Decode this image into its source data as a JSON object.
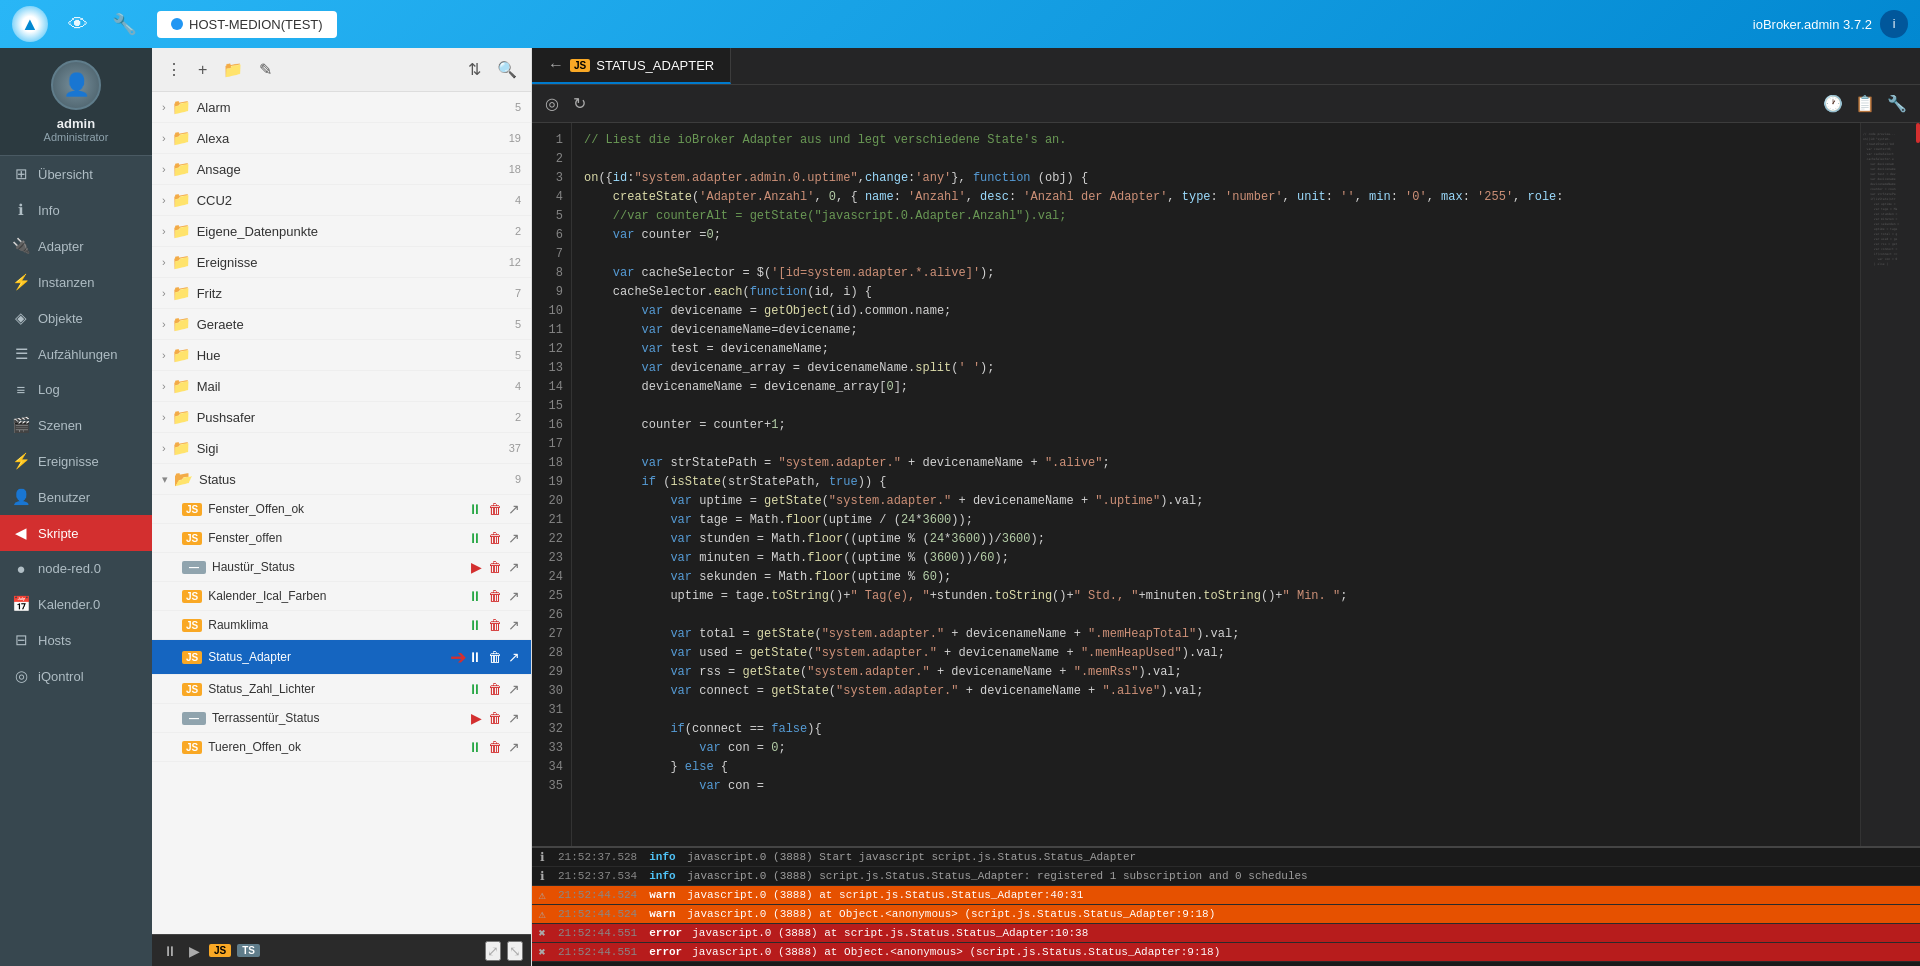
{
  "topbar": {
    "logo_text": "▲",
    "eye_icon": "👁",
    "wrench_icon": "🔧",
    "host_label": "HOST-MEDION(TEST)",
    "app_version": "ioBroker.admin 3.7.2",
    "right_icon": "i"
  },
  "sidebar": {
    "username": "admin",
    "role": "Administrator",
    "items": [
      {
        "id": "uebersicht",
        "label": "Übersicht",
        "icon": "⊞"
      },
      {
        "id": "info",
        "label": "Info",
        "icon": "ℹ"
      },
      {
        "id": "adapter",
        "label": "Adapter",
        "icon": "🧩"
      },
      {
        "id": "instanzen",
        "label": "Instanzen",
        "icon": "⚡"
      },
      {
        "id": "objekte",
        "label": "Objekte",
        "icon": "◈"
      },
      {
        "id": "aufzaehlungen",
        "label": "Aufzählungen",
        "icon": "☰"
      },
      {
        "id": "log",
        "label": "Log",
        "icon": "≡",
        "active": true
      },
      {
        "id": "szenen",
        "label": "Szenen",
        "icon": "🎬"
      },
      {
        "id": "ereignisse",
        "label": "Ereignisse",
        "icon": "⚡"
      },
      {
        "id": "benutzer",
        "label": "Benutzer",
        "icon": "👤"
      },
      {
        "id": "skripte",
        "label": "Skripte",
        "icon": "◀",
        "highlighted": true
      },
      {
        "id": "node-red",
        "label": "node-red.0",
        "icon": "●"
      },
      {
        "id": "kalender",
        "label": "Kalender.0",
        "icon": "📅"
      },
      {
        "id": "hosts",
        "label": "Hosts",
        "icon": "⊟"
      },
      {
        "id": "iqontrol",
        "label": "iQontrol",
        "icon": "◎"
      }
    ]
  },
  "script_panel": {
    "toolbar": {
      "menu_icon": "⋮",
      "add_icon": "+",
      "folder_icon": "📁",
      "edit_icon": "✎",
      "sort_icon": "⇅",
      "search_icon": "🔍"
    },
    "folders": [
      {
        "name": "Alarm",
        "count": 5,
        "open": false
      },
      {
        "name": "Alexa",
        "count": 19,
        "open": false
      },
      {
        "name": "Ansage",
        "count": 18,
        "open": false
      },
      {
        "name": "CCU2",
        "count": 4,
        "open": false
      },
      {
        "name": "Eigene_Datenpunkte",
        "count": 2,
        "open": false
      },
      {
        "name": "Ereignisse",
        "count": 12,
        "open": false
      },
      {
        "name": "Fritz",
        "count": 7,
        "open": false
      },
      {
        "name": "Geraete",
        "count": 5,
        "open": false
      },
      {
        "name": "Hue",
        "count": 5,
        "open": false
      },
      {
        "name": "Mail",
        "count": 4,
        "open": false
      },
      {
        "name": "Pushsafer",
        "count": 2,
        "open": false
      },
      {
        "name": "Sigi",
        "count": 37,
        "open": false
      }
    ],
    "status_folder": {
      "name": "Status",
      "count": 9,
      "open": true,
      "items": [
        {
          "name": "Fenster_Offen_ok",
          "type": "js",
          "running": true
        },
        {
          "name": "Fenster_offen",
          "type": "js",
          "running": true
        },
        {
          "name": "Haustür_Status",
          "type": "dash",
          "running": false
        },
        {
          "name": "Kalender_Ical_Farben",
          "type": "js",
          "running": true
        },
        {
          "name": "Raumklima",
          "type": "js",
          "running": true
        },
        {
          "name": "Status_Adapter",
          "type": "js",
          "running": true,
          "selected": true
        },
        {
          "name": "Status_Zahl_Lichter",
          "type": "js",
          "running": true
        },
        {
          "name": "Terrassentür_Status",
          "type": "dash",
          "running": false
        },
        {
          "name": "Tueren_Offen_ok",
          "type": "js",
          "running": true
        }
      ]
    }
  },
  "editor": {
    "tab_label": "STATUS_ADAPTER",
    "back_label": "←",
    "code_lines": [
      {
        "n": 1,
        "text": "// Liest die ioBroker Adapter aus und legt verschiedene State's an.",
        "type": "comment"
      },
      {
        "n": 2,
        "text": "",
        "type": "blank"
      },
      {
        "n": 3,
        "text": "on({id:\"system.adapter.admin.0.uptime\",change:'any'}, function (obj) {",
        "type": "code"
      },
      {
        "n": 4,
        "text": "    createState('Adapter.Anzahl', 0, { name: 'Anzahl', desc: 'Anzahl der Adapter', type: 'number', unit: '', min: '0', max: '255', role:",
        "type": "code"
      },
      {
        "n": 5,
        "text": "    //var counterAlt = getState(\"javascript.0.Adapter.Anzahl\").val;",
        "type": "comment"
      },
      {
        "n": 6,
        "text": "    var counter =0;",
        "type": "code"
      },
      {
        "n": 7,
        "text": "",
        "type": "blank"
      },
      {
        "n": 8,
        "text": "    var cacheSelector = $('[id=system.adapter.*.alive]');",
        "type": "code"
      },
      {
        "n": 9,
        "text": "    cacheSelector.each(function(id, i) {",
        "type": "code"
      },
      {
        "n": 10,
        "text": "        var devicename = getObject(id).common.name;",
        "type": "code"
      },
      {
        "n": 11,
        "text": "        var devicenameName=devicename;",
        "type": "code"
      },
      {
        "n": 12,
        "text": "        var test = devicenameName;",
        "type": "code"
      },
      {
        "n": 13,
        "text": "        var devicename_array = devicenameName.split(' ');",
        "type": "code"
      },
      {
        "n": 14,
        "text": "        devicenameName = devicename_array[0];",
        "type": "code"
      },
      {
        "n": 15,
        "text": "",
        "type": "blank"
      },
      {
        "n": 16,
        "text": "        counter = counter+1;",
        "type": "code"
      },
      {
        "n": 17,
        "text": "",
        "type": "blank"
      },
      {
        "n": 18,
        "text": "        var strStatePath = \"system.adapter.\" + devicenameName + \".alive\";",
        "type": "code"
      },
      {
        "n": 19,
        "text": "        if (isState(strStatePath, true)) {",
        "type": "code"
      },
      {
        "n": 20,
        "text": "            var uptime = getState(\"system.adapter.\" + devicenameName + \".uptime\").val;",
        "type": "code"
      },
      {
        "n": 21,
        "text": "            var tage = Math.floor(uptime / (24*3600));",
        "type": "code"
      },
      {
        "n": 22,
        "text": "            var stunden = Math.floor((uptime % (24*3600))/3600);",
        "type": "code"
      },
      {
        "n": 23,
        "text": "            var minuten = Math.floor((uptime % (3600))/60);",
        "type": "code"
      },
      {
        "n": 24,
        "text": "            var sekunden = Math.floor(uptime % 60);",
        "type": "code"
      },
      {
        "n": 25,
        "text": "            uptime = tage.toString()+\" Tag(e), \"+stunden.toString()+\" Std., \"+minuten.toString()+\" Min. \";",
        "type": "code"
      },
      {
        "n": 26,
        "text": "",
        "type": "blank"
      },
      {
        "n": 27,
        "text": "            var total = getState(\"system.adapter.\" + devicenameName + \".memHeapTotal\").val;",
        "type": "code"
      },
      {
        "n": 28,
        "text": "            var used = getState(\"system.adapter.\" + devicenameName + \".memHeapUsed\").val;",
        "type": "code"
      },
      {
        "n": 29,
        "text": "            var rss = getState(\"system.adapter.\" + devicenameName + \".memRss\").val;",
        "type": "code"
      },
      {
        "n": 30,
        "text": "            var connect = getState(\"system.adapter.\" + devicenameName + \".alive\").val;",
        "type": "code"
      },
      {
        "n": 31,
        "text": "",
        "type": "blank"
      },
      {
        "n": 32,
        "text": "            if(connect == false){",
        "type": "code"
      },
      {
        "n": 33,
        "text": "                var con = 0;",
        "type": "code"
      },
      {
        "n": 34,
        "text": "            } else {",
        "type": "code"
      },
      {
        "n": 35,
        "text": "                var con =",
        "type": "code"
      }
    ]
  },
  "log": {
    "entries": [
      {
        "type": "info",
        "time": "21:52:37.528",
        "level": "info",
        "msg": "javascript.0 (3888) Start javascript script.js.Status.Status_Adapter"
      },
      {
        "type": "info",
        "time": "21:52:37.534",
        "level": "info",
        "msg": "javascript.0 (3888) script.js.Status.Status_Adapter: registered 1 subscription and 0 schedules"
      },
      {
        "type": "warn",
        "time": "21:52:44.524",
        "level": "warn",
        "msg": "javascript.0 (3888) at script.js.Status.Status_Adapter:40:31"
      },
      {
        "type": "warn",
        "time": "21:52:44.524",
        "level": "warn",
        "msg": "javascript.0 (3888) at Object.<anonymous> (script.js.Status.Status_Adapter:9:18)"
      },
      {
        "type": "error",
        "time": "21:52:44.551",
        "level": "error",
        "msg": "javascript.0 (3888) at script.js.Status.Status_Adapter:10:38"
      },
      {
        "type": "error",
        "time": "21:52:44.551",
        "level": "error",
        "msg": "javascript.0 (3888) at Object.<anonymous> (script.js.Status.Status_Adapter:9:18)"
      }
    ]
  },
  "bottom_bar": {
    "pause_icon": "⏸",
    "play_icon": "▶",
    "js_label": "JS",
    "ts_label": "TS",
    "expand_icon": "⤢",
    "collapse_icon": "⤡"
  }
}
